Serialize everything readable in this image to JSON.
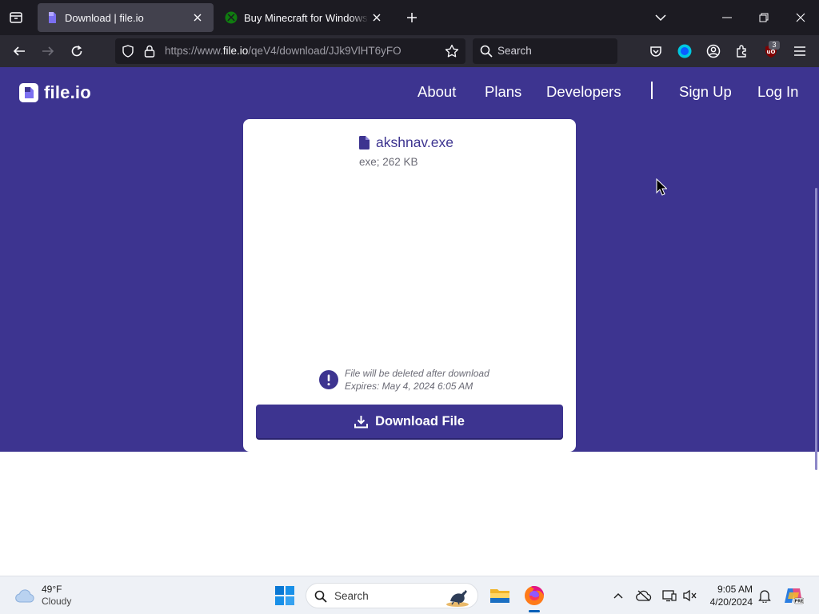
{
  "browser": {
    "tabs": [
      {
        "title": "Download | file.io",
        "active": true,
        "favicon": "file-io-favicon"
      },
      {
        "title": "Buy Minecraft for Windows | Xbox",
        "active": false,
        "favicon": "xbox-favicon"
      }
    ],
    "url": {
      "prefix": "https://www.",
      "host": "file.io",
      "path": "/qeV4/download/JJk9VlHT6yFO"
    },
    "search_placeholder": "Search",
    "extension_badge": "3"
  },
  "site": {
    "logo_text": "file.io",
    "nav": [
      "About",
      "Plans",
      "Developers",
      "Sign Up",
      "Log In"
    ],
    "accent": "#3d3490"
  },
  "file": {
    "name": "akshnav.exe",
    "meta": "exe; 262 KB",
    "notice_line1": "File will be deleted after download",
    "notice_line2": "Expires: May 4, 2024 6:05 AM",
    "download_label": "Download File"
  },
  "taskbar": {
    "weather_temp": "49°F",
    "weather_cond": "Cloudy",
    "search_label": "Search",
    "time": "9:05 AM",
    "date": "4/20/2024"
  }
}
